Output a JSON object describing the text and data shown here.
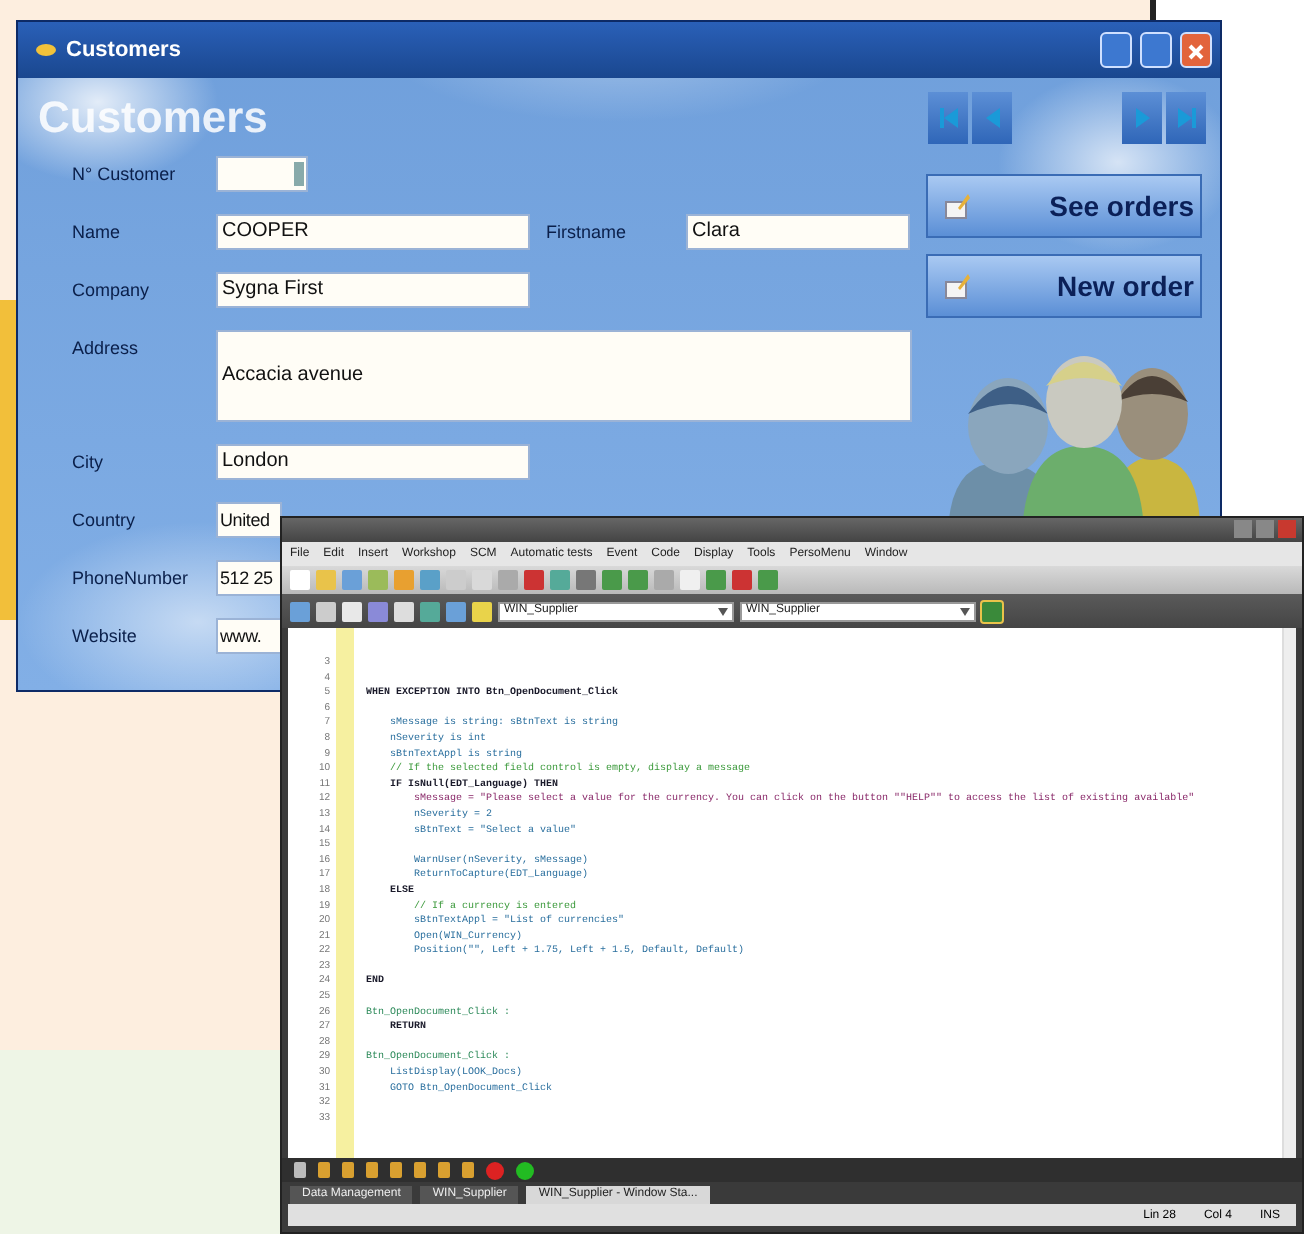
{
  "customers_window": {
    "title": "Customers",
    "heading": "Customers",
    "fields": [
      {
        "label": "N° Customer",
        "kind": "spin"
      },
      {
        "label": "Name",
        "value": "COOPER",
        "kind": "text",
        "extra": {
          "label": "Firstname",
          "value": "Clara"
        }
      },
      {
        "label": "Company",
        "value": "Sygna First",
        "kind": "text"
      },
      {
        "label": "Address",
        "value": "Accacia avenue",
        "kind": "memo"
      },
      {
        "label": "City",
        "value": "London",
        "kind": "text"
      },
      {
        "label": "Country",
        "value": "United",
        "kind": "cut"
      },
      {
        "label": "PhoneNumber",
        "value": "512 25",
        "kind": "cut"
      },
      {
        "label": "Website",
        "value": "www.",
        "kind": "cut"
      }
    ],
    "nav_buttons": [
      {
        "kind": "first"
      },
      {
        "kind": "previous"
      },
      {
        "kind": "next"
      },
      {
        "kind": "last"
      }
    ],
    "action_buttons": [
      {
        "label": "See orders"
      },
      {
        "label": "New order"
      }
    ]
  },
  "editor_window": {
    "menu": [
      "File",
      "Edit",
      "Insert",
      "Workshop",
      "SCM",
      "Automatic tests",
      "Event",
      "Code",
      "Display",
      "Tools",
      "PersoMenu",
      "Window"
    ],
    "combos": [
      "WIN_Supplier",
      "WIN_Supplier"
    ],
    "code_lines": [
      {
        "number": "3",
        "kind": "code"
      },
      {
        "number": "4",
        "kind": "code"
      },
      {
        "number": "5",
        "text": "WHEN EXCEPTION INTO Btn_OpenDocument_Click",
        "kind": "keyword"
      },
      {
        "number": "6",
        "kind": "code"
      },
      {
        "number": "7",
        "text": "    sMessage is string: sBtnText is string",
        "kind": "code"
      },
      {
        "number": "8",
        "text": "    nSeverity is int",
        "kind": "code"
      },
      {
        "number": "9",
        "text": "    sBtnTextAppl is string",
        "kind": "code"
      },
      {
        "number": "10",
        "text": "    // If the selected field control is empty, display a message",
        "kind": "comment"
      },
      {
        "number": "11",
        "text": "    IF IsNull(EDT_Language) THEN",
        "kind": "keyword"
      },
      {
        "number": "12",
        "text": "        sMessage = \"Please select a value for the currency. You can click on the button \"\"HELP\"\" to access the list of existing available\"",
        "kind": "string"
      },
      {
        "number": "13",
        "text": "        nSeverity = 2",
        "kind": "code"
      },
      {
        "number": "14",
        "text": "        sBtnText = \"Select a value\"",
        "kind": "code"
      },
      {
        "number": "15",
        "kind": "code"
      },
      {
        "number": "16",
        "text": "        WarnUser(nSeverity, sMessage)",
        "kind": "code"
      },
      {
        "number": "17",
        "text": "        ReturnToCapture(EDT_Language)",
        "kind": "code"
      },
      {
        "number": "18",
        "text": "    ELSE",
        "kind": "keyword"
      },
      {
        "number": "19",
        "text": "        // If a currency is entered",
        "kind": "comment"
      },
      {
        "number": "20",
        "text": "        sBtnTextAppl = \"List of currencies\"",
        "kind": "code"
      },
      {
        "number": "21",
        "text": "        Open(WIN_Currency)",
        "kind": "code"
      },
      {
        "number": "22",
        "text": "        Position(\"\", Left + 1.75, Left + 1.5, Default, Default)",
        "kind": "code"
      },
      {
        "number": "23",
        "kind": "code"
      },
      {
        "number": "24",
        "text": "END",
        "kind": "keyword"
      },
      {
        "number": "25",
        "kind": "code"
      },
      {
        "number": "26",
        "text": "Btn_OpenDocument_Click :",
        "kind": "label"
      },
      {
        "number": "27",
        "text": "    RETURN",
        "kind": "keyword"
      },
      {
        "number": "28",
        "kind": "code"
      },
      {
        "number": "29",
        "text": "Btn_OpenDocument_Click :",
        "kind": "label"
      },
      {
        "number": "30",
        "text": "    ListDisplay(LOOK_Docs)",
        "kind": "code"
      },
      {
        "number": "31",
        "text": "    GOTO Btn_OpenDocument_Click",
        "kind": "code"
      },
      {
        "number": "32",
        "kind": "code"
      },
      {
        "number": "33",
        "kind": "code"
      }
    ],
    "tabs": [
      {
        "label": "Data Management",
        "selected": false
      },
      {
        "label": "WIN_Supplier",
        "selected": false
      },
      {
        "label": "WIN_Supplier - Window Sta...",
        "selected": true
      }
    ],
    "status": [
      "Lin 28",
      "Col 4",
      "INS"
    ]
  }
}
